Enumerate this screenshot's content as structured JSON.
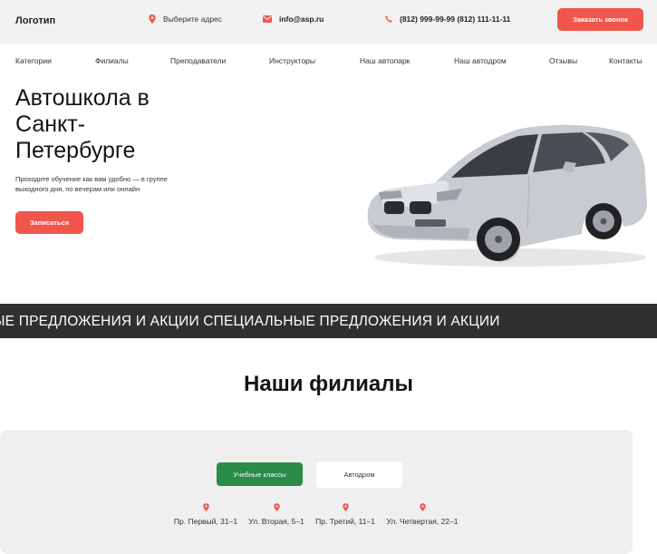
{
  "header": {
    "logo": "Логотип",
    "address_prompt": "Выберите адрес",
    "email": "info@asp.ru",
    "phones": "(812) 999-99-99 (812) 111-11-11",
    "call_button": "Заказать звонок"
  },
  "nav": {
    "items": [
      "Категории",
      "Филиалы",
      "Преподаватели",
      "Инструкторы",
      "Наш автопарк",
      "Наш автодром",
      "Отзывы",
      "Контакты"
    ]
  },
  "hero": {
    "title": "Автошкола в Санкт-Петербурге",
    "subtitle": "Проходите обучение как вам удобно — в группе выходного дня, по вечерам или онлайн",
    "button": "Записаться"
  },
  "ticker": {
    "text": "ЬНЫЕ ПРЕДЛОЖЕНИЯ И АКЦИИ СПЕЦИАЛЬНЫЕ ПРЕДЛОЖЕНИЯ И АКЦИИ"
  },
  "branches": {
    "title": "Наши филиалы",
    "tabs": [
      "Учебные классы",
      "Автодром"
    ],
    "addresses": [
      "Пр. Первый, 31–1",
      "Ул. Вторая, 5–1",
      "Пр. Третий, 11–1",
      "Ул. Четвертая, 22–1"
    ]
  },
  "colors": {
    "accent": "#f0564c",
    "green": "#2b8b48",
    "dark": "#303030"
  }
}
